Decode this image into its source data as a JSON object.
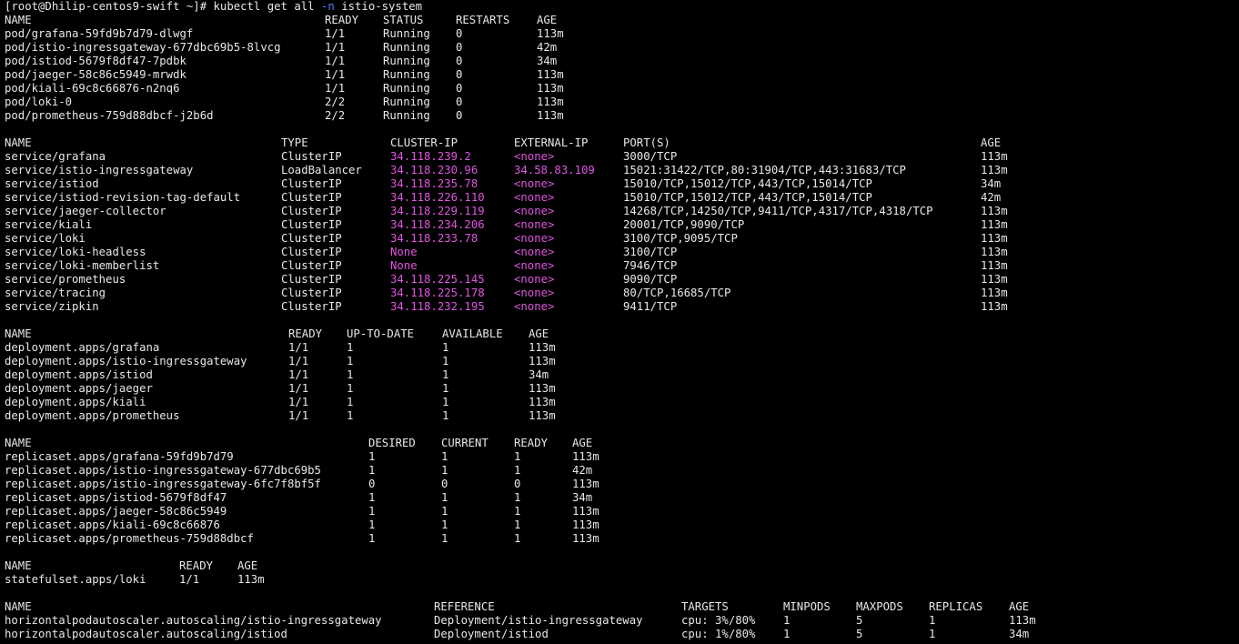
{
  "colors": {
    "background": "#000000",
    "text": "#e8e8e8",
    "flag": "#4f7fff",
    "ip": "#e055e0"
  },
  "prompt": {
    "user_host": "[root@Dhilip-centos9-swift ~]# ",
    "cmd_a": "kubectl get all ",
    "flag": "-n",
    "cmd_b": " istio-system"
  },
  "pods": {
    "headers": [
      "NAME",
      "READY",
      "STATUS",
      "RESTARTS",
      "AGE"
    ],
    "rows": [
      [
        "pod/grafana-59fd9b7d79-dlwgf",
        "1/1",
        "Running",
        "0",
        "113m"
      ],
      [
        "pod/istio-ingressgateway-677dbc69b5-8lvcg",
        "1/1",
        "Running",
        "0",
        "42m"
      ],
      [
        "pod/istiod-5679f8df47-7pdbk",
        "1/1",
        "Running",
        "0",
        "34m"
      ],
      [
        "pod/jaeger-58c86c5949-mrwdk",
        "1/1",
        "Running",
        "0",
        "113m"
      ],
      [
        "pod/kiali-69c8c66876-n2nq6",
        "1/1",
        "Running",
        "0",
        "113m"
      ],
      [
        "pod/loki-0",
        "2/2",
        "Running",
        "0",
        "113m"
      ],
      [
        "pod/prometheus-759d88dbcf-j2b6d",
        "2/2",
        "Running",
        "0",
        "113m"
      ]
    ]
  },
  "services": {
    "headers": [
      "NAME",
      "TYPE",
      "CLUSTER-IP",
      "EXTERNAL-IP",
      "PORT(S)",
      "AGE"
    ],
    "rows": [
      [
        "service/grafana",
        "ClusterIP",
        "34.118.239.2",
        "<none>",
        "3000/TCP",
        "113m"
      ],
      [
        "service/istio-ingressgateway",
        "LoadBalancer",
        "34.118.230.96",
        "34.58.83.109",
        "15021:31422/TCP,80:31904/TCP,443:31683/TCP",
        "113m"
      ],
      [
        "service/istiod",
        "ClusterIP",
        "34.118.235.78",
        "<none>",
        "15010/TCP,15012/TCP,443/TCP,15014/TCP",
        "34m"
      ],
      [
        "service/istiod-revision-tag-default",
        "ClusterIP",
        "34.118.226.110",
        "<none>",
        "15010/TCP,15012/TCP,443/TCP,15014/TCP",
        "42m"
      ],
      [
        "service/jaeger-collector",
        "ClusterIP",
        "34.118.229.119",
        "<none>",
        "14268/TCP,14250/TCP,9411/TCP,4317/TCP,4318/TCP",
        "113m"
      ],
      [
        "service/kiali",
        "ClusterIP",
        "34.118.234.206",
        "<none>",
        "20001/TCP,9090/TCP",
        "113m"
      ],
      [
        "service/loki",
        "ClusterIP",
        "34.118.233.78",
        "<none>",
        "3100/TCP,9095/TCP",
        "113m"
      ],
      [
        "service/loki-headless",
        "ClusterIP",
        "None",
        "<none>",
        "3100/TCP",
        "113m"
      ],
      [
        "service/loki-memberlist",
        "ClusterIP",
        "None",
        "<none>",
        "7946/TCP",
        "113m"
      ],
      [
        "service/prometheus",
        "ClusterIP",
        "34.118.225.145",
        "<none>",
        "9090/TCP",
        "113m"
      ],
      [
        "service/tracing",
        "ClusterIP",
        "34.118.225.178",
        "<none>",
        "80/TCP,16685/TCP",
        "113m"
      ],
      [
        "service/zipkin",
        "ClusterIP",
        "34.118.232.195",
        "<none>",
        "9411/TCP",
        "113m"
      ]
    ]
  },
  "deployments": {
    "headers": [
      "NAME",
      "READY",
      "UP-TO-DATE",
      "AVAILABLE",
      "AGE"
    ],
    "rows": [
      [
        "deployment.apps/grafana",
        "1/1",
        "1",
        "1",
        "113m"
      ],
      [
        "deployment.apps/istio-ingressgateway",
        "1/1",
        "1",
        "1",
        "113m"
      ],
      [
        "deployment.apps/istiod",
        "1/1",
        "1",
        "1",
        "34m"
      ],
      [
        "deployment.apps/jaeger",
        "1/1",
        "1",
        "1",
        "113m"
      ],
      [
        "deployment.apps/kiali",
        "1/1",
        "1",
        "1",
        "113m"
      ],
      [
        "deployment.apps/prometheus",
        "1/1",
        "1",
        "1",
        "113m"
      ]
    ]
  },
  "replicasets": {
    "headers": [
      "NAME",
      "DESIRED",
      "CURRENT",
      "READY",
      "AGE"
    ],
    "rows": [
      [
        "replicaset.apps/grafana-59fd9b7d79",
        "1",
        "1",
        "1",
        "113m"
      ],
      [
        "replicaset.apps/istio-ingressgateway-677dbc69b5",
        "1",
        "1",
        "1",
        "42m"
      ],
      [
        "replicaset.apps/istio-ingressgateway-6fc7f8bf5f",
        "0",
        "0",
        "0",
        "113m"
      ],
      [
        "replicaset.apps/istiod-5679f8df47",
        "1",
        "1",
        "1",
        "34m"
      ],
      [
        "replicaset.apps/jaeger-58c86c5949",
        "1",
        "1",
        "1",
        "113m"
      ],
      [
        "replicaset.apps/kiali-69c8c66876",
        "1",
        "1",
        "1",
        "113m"
      ],
      [
        "replicaset.apps/prometheus-759d88dbcf",
        "1",
        "1",
        "1",
        "113m"
      ]
    ]
  },
  "statefulsets": {
    "headers": [
      "NAME",
      "READY",
      "AGE"
    ],
    "rows": [
      [
        "statefulset.apps/loki",
        "1/1",
        "113m"
      ]
    ]
  },
  "hpas": {
    "headers": [
      "NAME",
      "REFERENCE",
      "TARGETS",
      "MINPODS",
      "MAXPODS",
      "REPLICAS",
      "AGE"
    ],
    "rows": [
      [
        "horizontalpodautoscaler.autoscaling/istio-ingressgateway",
        "Deployment/istio-ingressgateway",
        "cpu: 3%/80%",
        "1",
        "5",
        "1",
        "113m"
      ],
      [
        "horizontalpodautoscaler.autoscaling/istiod",
        "Deployment/istiod",
        "cpu: 1%/80%",
        "1",
        "5",
        "1",
        "34m"
      ]
    ]
  }
}
